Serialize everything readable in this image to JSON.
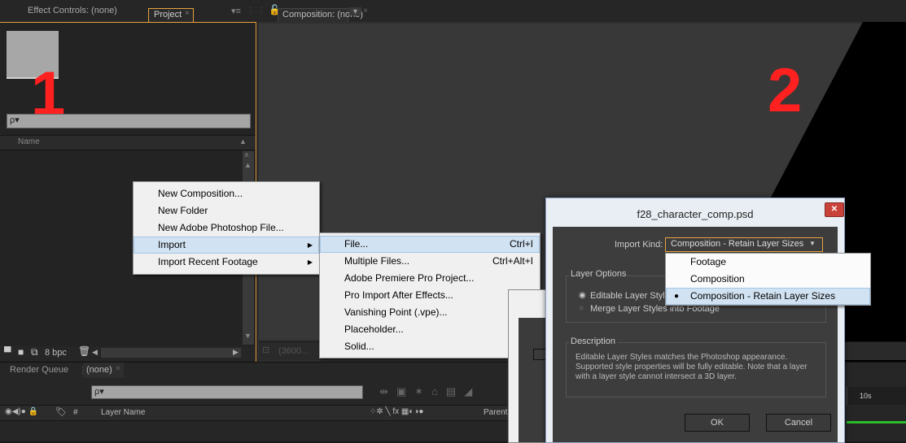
{
  "tabs": {
    "effect_controls": "Effect Controls: (none)",
    "project": "Project",
    "composition": "Composition: (none)",
    "render_queue": "Render Queue",
    "timeline_none": "(none)"
  },
  "project_panel": {
    "search_glyph": "ρ▾",
    "name_header": "Name",
    "bpc": "8 bpc"
  },
  "composition_panel": {
    "zoom_label": "(3600..."
  },
  "annotations": {
    "one": "1",
    "two": "2",
    "color": "#ff2020"
  },
  "context_menu": {
    "items": [
      {
        "label": "New Composition..."
      },
      {
        "label": "New Folder"
      },
      {
        "label": "New Adobe Photoshop File..."
      },
      {
        "label": "Import",
        "submenu": true,
        "highlighted": true
      },
      {
        "label": "Import Recent Footage",
        "submenu": true
      }
    ]
  },
  "import_submenu": {
    "items": [
      {
        "label": "File...",
        "shortcut": "Ctrl+I",
        "highlighted": true
      },
      {
        "label": "Multiple Files...",
        "shortcut": "Ctrl+Alt+I"
      },
      {
        "label": "Adobe Premiere Pro Project...",
        "shortcut": ""
      },
      {
        "label": "Pro Import After Effects...",
        "shortcut": ""
      },
      {
        "label": "Vanishing Point (.vpe)...",
        "shortcut": ""
      },
      {
        "label": "Placeholder...",
        "shortcut": ""
      },
      {
        "label": "Solid...",
        "shortcut": ""
      }
    ]
  },
  "dialog": {
    "title": "f28_character_comp.psd",
    "import_kind_label": "Import Kind:",
    "import_kind_value": "Composition - Retain Layer Sizes",
    "layer_options_label": "Layer Options",
    "option_editable": "Editable Layer Styles",
    "option_merge": "Merge Layer Styles into Footage",
    "description_label": "Description",
    "description_text": "Editable Layer Styles matches the Photoshop appearance. Supported style properties will be fully editable. Note that a layer with a layer style cannot intersect a 3D layer.",
    "ok": "OK",
    "cancel": "Cancel",
    "close_glyph": "✕"
  },
  "dropdown": {
    "options": [
      {
        "label": "Footage"
      },
      {
        "label": "Composition"
      },
      {
        "label": "Composition - Retain Layer Sizes",
        "selected": true
      }
    ]
  },
  "timeline": {
    "switches": "◉◀)● 🔒",
    "hash": "#",
    "layer_name": "Layer Name",
    "fx_icons": "⁘✲ ╲ fx ▦◐◑●",
    "parent": "Parent",
    "time_marker": "10s"
  },
  "colors": {
    "accent_orange": "#e8a33d",
    "menu_highlight": "#d1e2f2",
    "panel_bg": "#232323",
    "timeline_green": "#2bbd2b"
  }
}
